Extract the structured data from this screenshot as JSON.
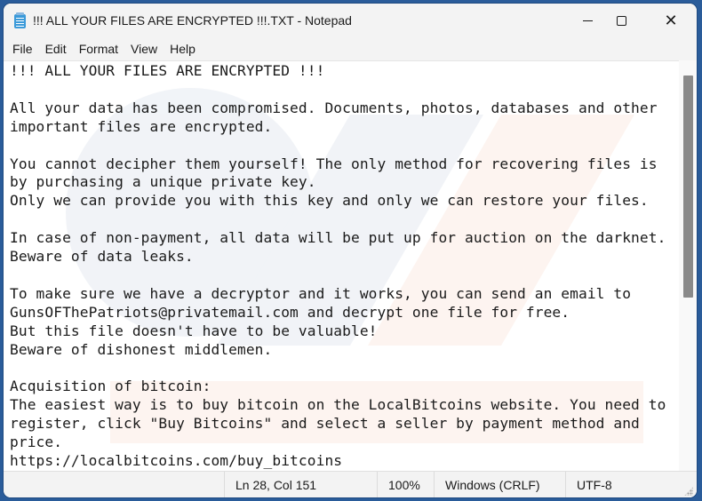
{
  "window": {
    "title": "!!! ALL YOUR FILES ARE ENCRYPTED !!!.TXT - Notepad",
    "app_icon": "notepad-icon",
    "controls": {
      "minimize": "minimize-icon",
      "maximize": "maximize-icon",
      "close": "close-icon",
      "close_glyph": "✕"
    }
  },
  "menu": {
    "items": [
      {
        "label": "File"
      },
      {
        "label": "Edit"
      },
      {
        "label": "Format"
      },
      {
        "label": "View"
      },
      {
        "label": "Help"
      }
    ]
  },
  "editor": {
    "content": "!!! ALL YOUR FILES ARE ENCRYPTED !!!\n\nAll your data has been compromised. Documents, photos, databases and other\nimportant files are encrypted.\n\nYou cannot decipher them yourself! The only method for recovering files is\nby purchasing a unique private key.\nOnly we can provide you with this key and only we can restore your files.\n\nIn case of non-payment, all data will be put up for auction on the darknet.\nBeware of data leaks.\n\nTo make sure we have a decryptor and it works, you can send an email to\nGunsOFThePatriots@privatemail.com and decrypt one file for free.\nBut this file doesn't have to be valuable!\nBeware of dishonest middlemen.\n\nAcquisition of bitcoin:\nThe easiest way is to buy bitcoin on the LocalBitcoins website. You need to\nregister, click \"Buy Bitcoins\" and select a seller by payment method and\nprice.\nhttps://localbitcoins.com/buy_bitcoins"
  },
  "statusbar": {
    "position": "Ln 28, Col 151",
    "zoom": "100%",
    "line_ending": "Windows (CRLF)",
    "encoding": "UTF-8"
  },
  "colors": {
    "desktop": "#2a5c9a",
    "chrome": "#f3f3f3",
    "editor_bg": "#ffffff",
    "text": "#1a1a1a",
    "scroll_thumb": "#8a8a8a"
  }
}
